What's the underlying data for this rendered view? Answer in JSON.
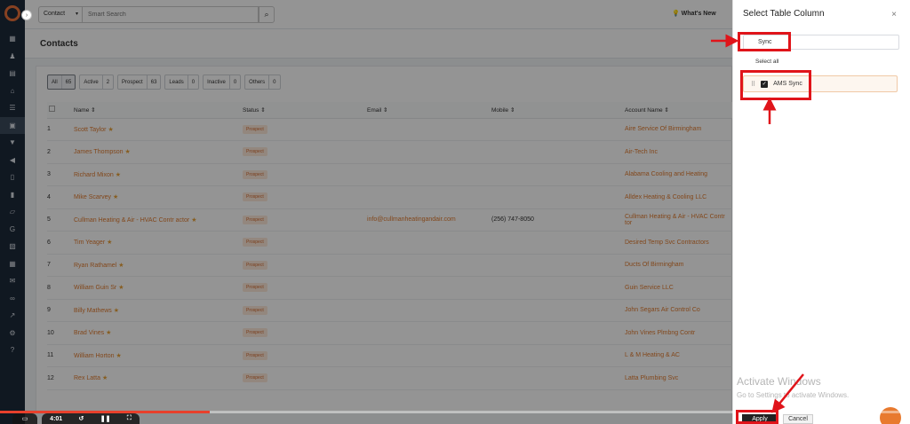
{
  "sidebar": {
    "collapse_glyph": "›",
    "items": [
      {
        "icon": "dashboard-icon",
        "glyph": "▦"
      },
      {
        "icon": "users-icon",
        "glyph": "♟"
      },
      {
        "icon": "briefcase-icon",
        "glyph": "▤"
      },
      {
        "icon": "bank-icon",
        "glyph": "⌂"
      },
      {
        "icon": "list-icon",
        "glyph": "☰"
      },
      {
        "icon": "contact-card-icon",
        "glyph": "▣"
      },
      {
        "icon": "filter-icon",
        "glyph": "▼"
      },
      {
        "icon": "megaphone-icon",
        "glyph": "◀"
      },
      {
        "icon": "document-icon",
        "glyph": "▯"
      },
      {
        "icon": "chart-icon",
        "glyph": "▮"
      },
      {
        "icon": "folder-icon",
        "glyph": "▱"
      },
      {
        "icon": "google-icon",
        "glyph": "G"
      },
      {
        "icon": "clipboard-icon",
        "glyph": "▧"
      },
      {
        "icon": "calendar-icon",
        "glyph": "▦"
      },
      {
        "icon": "mail-icon",
        "glyph": "✉"
      },
      {
        "icon": "handshake-icon",
        "glyph": "∞"
      },
      {
        "icon": "analytics-icon",
        "glyph": "↗"
      },
      {
        "icon": "settings-icon",
        "glyph": "⚙"
      },
      {
        "icon": "help-icon",
        "glyph": "?"
      }
    ]
  },
  "topbar": {
    "search_type": "Contact",
    "search_placeholder": "Smart Search",
    "search_icon_glyph": "⌕",
    "whats_new_glyph": "💡",
    "whats_new": "What's New"
  },
  "page": {
    "title": "Contacts"
  },
  "filters": [
    {
      "label": "All",
      "count": "65"
    },
    {
      "label": "Active",
      "count": "2"
    },
    {
      "label": "Prospect",
      "count": "63"
    },
    {
      "label": "Leads",
      "count": "0"
    },
    {
      "label": "Inactive",
      "count": "0"
    },
    {
      "label": "Others",
      "count": "0"
    }
  ],
  "table": {
    "headers": {
      "name": "Name ⇕",
      "status": "Status ⇕",
      "email": "Email ⇕",
      "mobile": "Mobile ⇕",
      "account": "Account Name ⇕"
    },
    "star_glyph": "★",
    "rows": [
      {
        "n": "1",
        "name": "Scott Taylor",
        "status": "Prospect",
        "email": "",
        "mobile": "",
        "account": "Aire Service Of Birmingham"
      },
      {
        "n": "2",
        "name": "James Thompson",
        "status": "Prospect",
        "email": "",
        "mobile": "",
        "account": "Air-Tech Inc"
      },
      {
        "n": "3",
        "name": "Richard Mixon",
        "status": "Prospect",
        "email": "",
        "mobile": "",
        "account": "Alabama Cooling and Heating"
      },
      {
        "n": "4",
        "name": "Mike Scarvey",
        "status": "Prospect",
        "email": "",
        "mobile": "",
        "account": "Alldex Heating & Cooling LLC"
      },
      {
        "n": "5",
        "name": "Cullman Heating & Air - HVAC Contr actor",
        "status": "Prospect",
        "email": "info@cullmanheatingandair.com",
        "mobile": "(256) 747-8050",
        "account": "Cullman Heating & Air - HVAC Contr tor"
      },
      {
        "n": "6",
        "name": "Tim Yeager",
        "status": "Prospect",
        "email": "",
        "mobile": "",
        "account": "Desired Temp Svc Contractors"
      },
      {
        "n": "7",
        "name": "Ryan Rathamel",
        "status": "Prospect",
        "email": "",
        "mobile": "",
        "account": "Ducts Of Birmingham"
      },
      {
        "n": "8",
        "name": "William Guin Sr",
        "status": "Prospect",
        "email": "",
        "mobile": "",
        "account": "Guin Service LLC"
      },
      {
        "n": "9",
        "name": "Billy Mathews",
        "status": "Prospect",
        "email": "",
        "mobile": "",
        "account": "John Segars Air Control Co"
      },
      {
        "n": "10",
        "name": "Brad Vines",
        "status": "Prospect",
        "email": "",
        "mobile": "",
        "account": "John Vines Plmbng Contr"
      },
      {
        "n": "11",
        "name": "William Horton",
        "status": "Prospect",
        "email": "",
        "mobile": "",
        "account": "L & M Heating & AC"
      },
      {
        "n": "12",
        "name": "Rex Latta",
        "status": "Prospect",
        "email": "",
        "mobile": "",
        "account": "Latta Plumbing Svc"
      }
    ]
  },
  "player": {
    "time": "4:01",
    "progress": 0.23,
    "controls": {
      "left": "▭",
      "replay": "↺",
      "pause": "❚❚",
      "fullscreen": "⛶"
    }
  },
  "panel": {
    "title": "Select Table Column",
    "close_glyph": "×",
    "search_icon_glyph": "⌕",
    "search_value": "Sync",
    "select_all": "Select all",
    "columns": [
      {
        "label": "AMS Sync",
        "checked": true,
        "drag_glyph": "⠿",
        "check_glyph": "✓"
      }
    ],
    "apply": "Apply",
    "cancel": "Cancel",
    "watermark_title": "Activate Windows",
    "watermark_sub": "Go to Settings to activate Windows."
  },
  "colors": {
    "accent": "#e07b2f",
    "annotation": "#e0141a",
    "sidebar": "#1c2a3a"
  }
}
